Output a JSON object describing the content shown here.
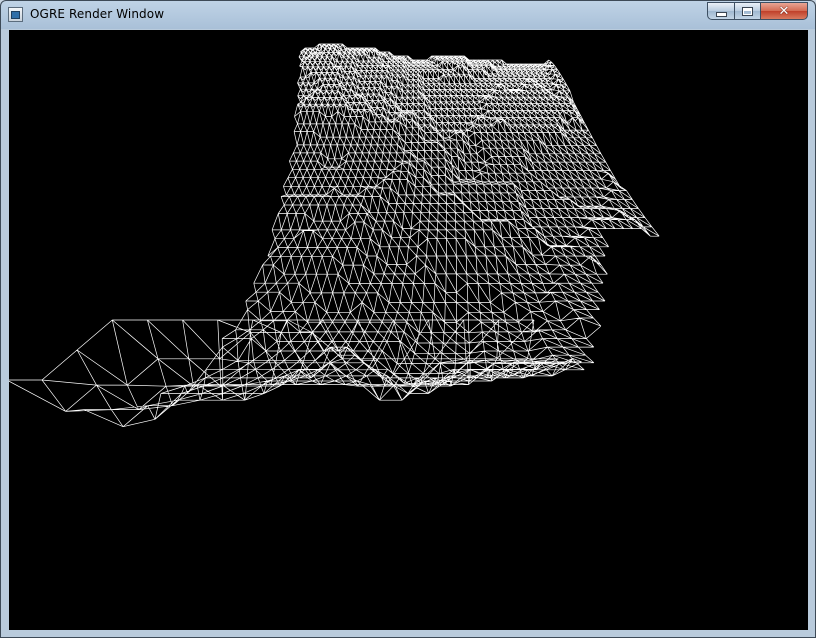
{
  "window": {
    "title": "OGRE Render Window",
    "icon": "ogre-app-icon",
    "controls": {
      "minimize": "minimize-icon",
      "maximize": "maximize-icon",
      "close": "close-icon"
    }
  },
  "viewport": {
    "background": "#000000",
    "wire_color": "#ffffff",
    "render_mode": "wireframe",
    "content": "terrain-mesh"
  }
}
